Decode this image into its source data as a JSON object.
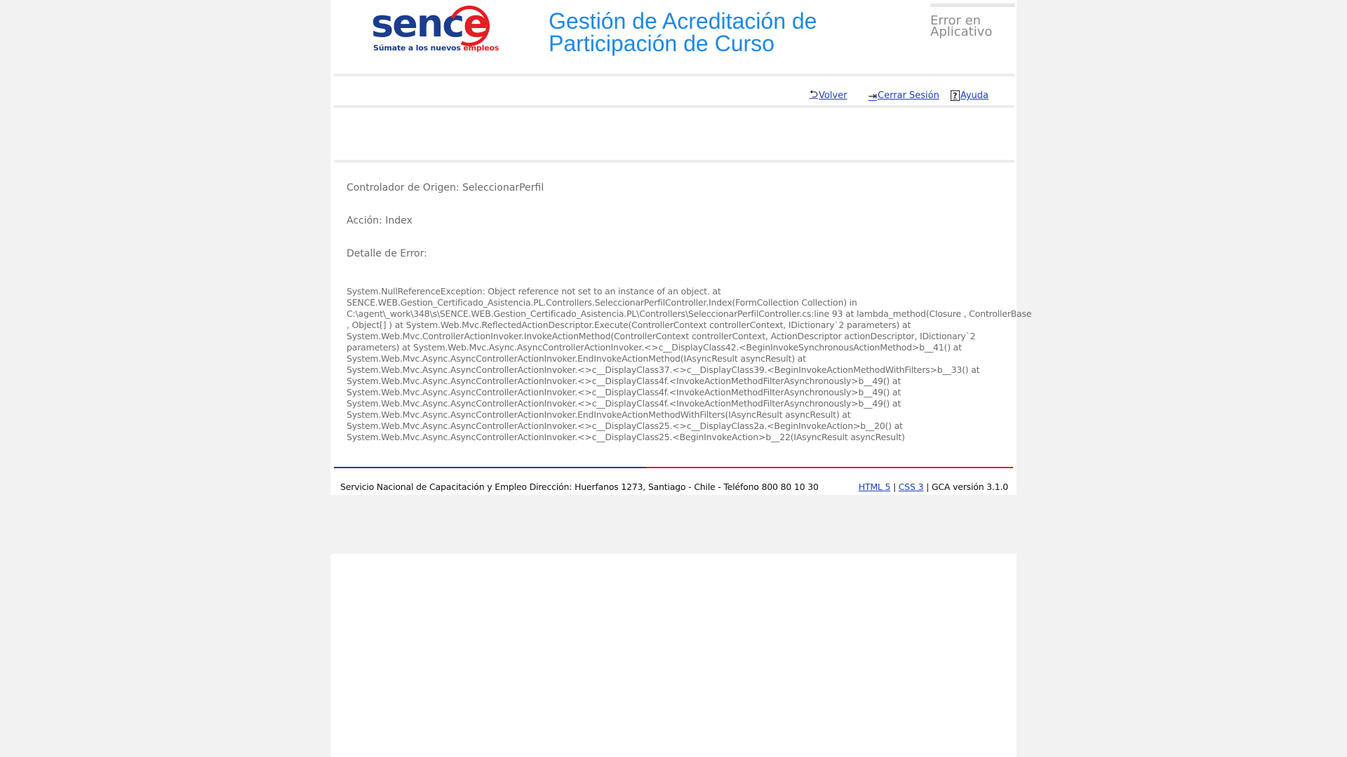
{
  "header": {
    "logo_word_main": "senc",
    "logo_word_accent": "e",
    "logo_tagline_main": "Súmate a los nuevos ",
    "logo_tagline_accent": "empleos",
    "app_title": "Gestión de Acreditación de Participación de Curso",
    "error_label": "Error en Aplicativo"
  },
  "nav": {
    "back_label": "Volver",
    "logout_label": "Cerrar Sesión",
    "help_label": "Ayuda"
  },
  "error": {
    "controller": "Controlador de Origen: SeleccionarPerfil",
    "action": "Acción: Index",
    "detail_label": "Detalle de Error:",
    "stack_lines": [
      "System.NullReferenceException: Object reference not set to an instance of an object. at",
      "SENCE.WEB.Gestion_Certificado_Asistencia.PL.Controllers.SeleccionarPerfilController.Index(FormCollection Collection) in",
      "C:\\agent\\_work\\348\\s\\SENCE.WEB.Gestion_Certificado_Asistencia.PL\\Controllers\\SeleccionarPerfilController.cs:line 93 at lambda_method(Closure , ControllerBase",
      ", Object[] ) at System.Web.Mvc.ReflectedActionDescriptor.Execute(ControllerContext controllerContext, IDictionary`2 parameters) at",
      "System.Web.Mvc.ControllerActionInvoker.InvokeActionMethod(ControllerContext controllerContext, ActionDescriptor actionDescriptor, IDictionary`2",
      "parameters) at System.Web.Mvc.Async.AsyncControllerActionInvoker.<>c__DisplayClass42.<BeginInvokeSynchronousActionMethod>b__41() at",
      "System.Web.Mvc.Async.AsyncControllerActionInvoker.EndInvokeActionMethod(IAsyncResult asyncResult) at",
      "System.Web.Mvc.Async.AsyncControllerActionInvoker.<>c__DisplayClass37.<>c__DisplayClass39.<BeginInvokeActionMethodWithFilters>b__33() at",
      "System.Web.Mvc.Async.AsyncControllerActionInvoker.<>c__DisplayClass4f.<InvokeActionMethodFilterAsynchronously>b__49() at",
      "System.Web.Mvc.Async.AsyncControllerActionInvoker.<>c__DisplayClass4f.<InvokeActionMethodFilterAsynchronously>b__49() at",
      "System.Web.Mvc.Async.AsyncControllerActionInvoker.<>c__DisplayClass4f.<InvokeActionMethodFilterAsynchronously>b__49() at",
      "System.Web.Mvc.Async.AsyncControllerActionInvoker.EndInvokeActionMethodWithFilters(IAsyncResult asyncResult) at",
      "System.Web.Mvc.Async.AsyncControllerActionInvoker.<>c__DisplayClass25.<>c__DisplayClass2a.<BeginInvokeAction>b__20() at",
      "System.Web.Mvc.Async.AsyncControllerActionInvoker.<>c__DisplayClass25.<BeginInvokeAction>b__22(IAsyncResult asyncResult)"
    ]
  },
  "footer": {
    "address": "Servicio Nacional de Capacitación y Empleo Dirección: Huerfanos 1273, Santiago - Chile - Teléfono 800 80 10 30",
    "html5_link": "HTML 5",
    "separator": "|",
    "css3_link": "CSS 3",
    "version": "GCA versión 3.1.0"
  },
  "colors": {
    "brand_blue": "#1b3d8f",
    "brand_red": "#e31e24",
    "title_blue": "#1e88e5",
    "link_blue": "#1a3fbf"
  },
  "icons": {
    "back": "undo-arrow-icon",
    "logout": "logout-icon",
    "help": "question-box-icon"
  }
}
